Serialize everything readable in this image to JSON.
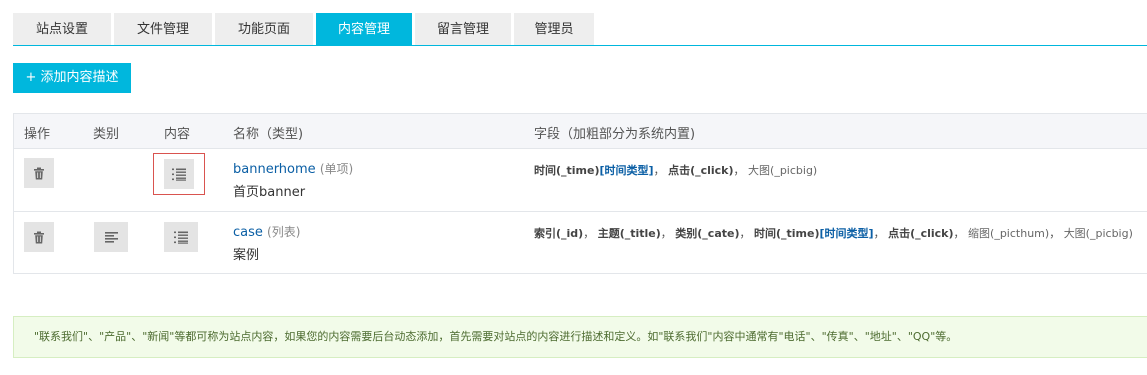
{
  "tabs": [
    {
      "label": "站点设置",
      "active": false
    },
    {
      "label": "文件管理",
      "active": false
    },
    {
      "label": "功能页面",
      "active": false
    },
    {
      "label": "内容管理",
      "active": true
    },
    {
      "label": "留言管理",
      "active": false
    },
    {
      "label": "管理员",
      "active": false
    }
  ],
  "add_button": {
    "label": "+ 添加内容描述"
  },
  "table": {
    "headers": {
      "action": "操作",
      "category": "类别",
      "content": "内容",
      "name": "名称（类型)",
      "fields": "字段（加粗部分为系统内置)"
    },
    "rows": [
      {
        "name": "bannerhome",
        "type": "(单项)",
        "desc": "首页banner",
        "fields": [
          {
            "strong": "时间(_time)",
            "type": "[时间类型]",
            "sep": "，"
          },
          {
            "strong": "点击(_click)",
            "sep": "，"
          },
          {
            "plain": "大图(_picbig)"
          }
        ]
      },
      {
        "name": "case",
        "type": "(列表)",
        "desc": "案例",
        "fields": [
          {
            "strong": "索引(_id)",
            "sep": "，"
          },
          {
            "strong": "主题(_title)",
            "sep": "，"
          },
          {
            "strong": "类别(_cate)",
            "sep": "，"
          },
          {
            "strong": "时间(_time)",
            "type": "[时间类型]",
            "sep": "，"
          },
          {
            "strong": "点击(_click)",
            "sep": "，"
          },
          {
            "plain": "缩图(_picthum)",
            "sep": "，"
          },
          {
            "plain": "大图(_picbig)"
          }
        ]
      }
    ]
  },
  "notice": "\"联系我们\"、\"产品\"、\"新闻\"等都可称为站点内容，如果您的内容需要后台动态添加，首先需要对站点的内容进行描述和定义。如\"联系我们\"内容中通常有\"电话\"、\"传真\"、\"地址\"、\"QQ\"等。",
  "colors": {
    "accent": "#00b7dd",
    "link": "#0b5fa5",
    "highlight": "#d9534f",
    "notice_bg": "#f2fbe9"
  },
  "icons": {
    "delete": "trash-icon",
    "category": "align-left-icon",
    "content": "ordered-list-icon"
  }
}
